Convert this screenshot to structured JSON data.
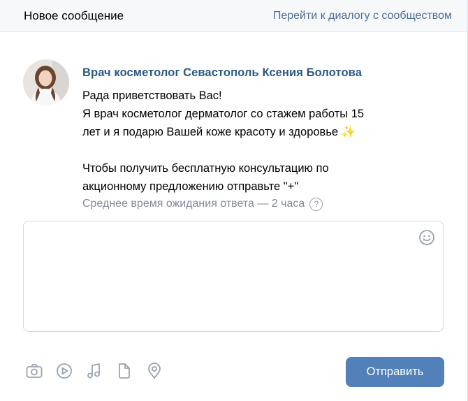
{
  "header": {
    "title": "Новое сообщение",
    "community_link": "Перейти к диалогу с сообществом"
  },
  "message": {
    "author": "Врач косметолог Севастополь Ксения Болотова",
    "lines": [
      "Рада приветствовать Вас!",
      "Я врач косметолог дерматолог со стажем работы 15",
      "лет и я подарю Вашей коже красоту и здоровье ✨",
      "",
      "Чтобы получить бесплатную консультацию по",
      "акционному предложению отправьте \"+\""
    ],
    "wait_time": "Среднее время ожидания ответа — 2 часа",
    "help_glyph": "?"
  },
  "composer": {
    "value": "",
    "placeholder": ""
  },
  "footer": {
    "icons": [
      "camera-icon",
      "video-icon",
      "music-icon",
      "document-icon",
      "location-icon"
    ],
    "send_label": "Отправить"
  },
  "colors": {
    "accent": "#5181b8",
    "link": "#4a6d96",
    "author": "#2a5885",
    "secondary_text": "#828a99",
    "icon": "#99a2ad"
  }
}
